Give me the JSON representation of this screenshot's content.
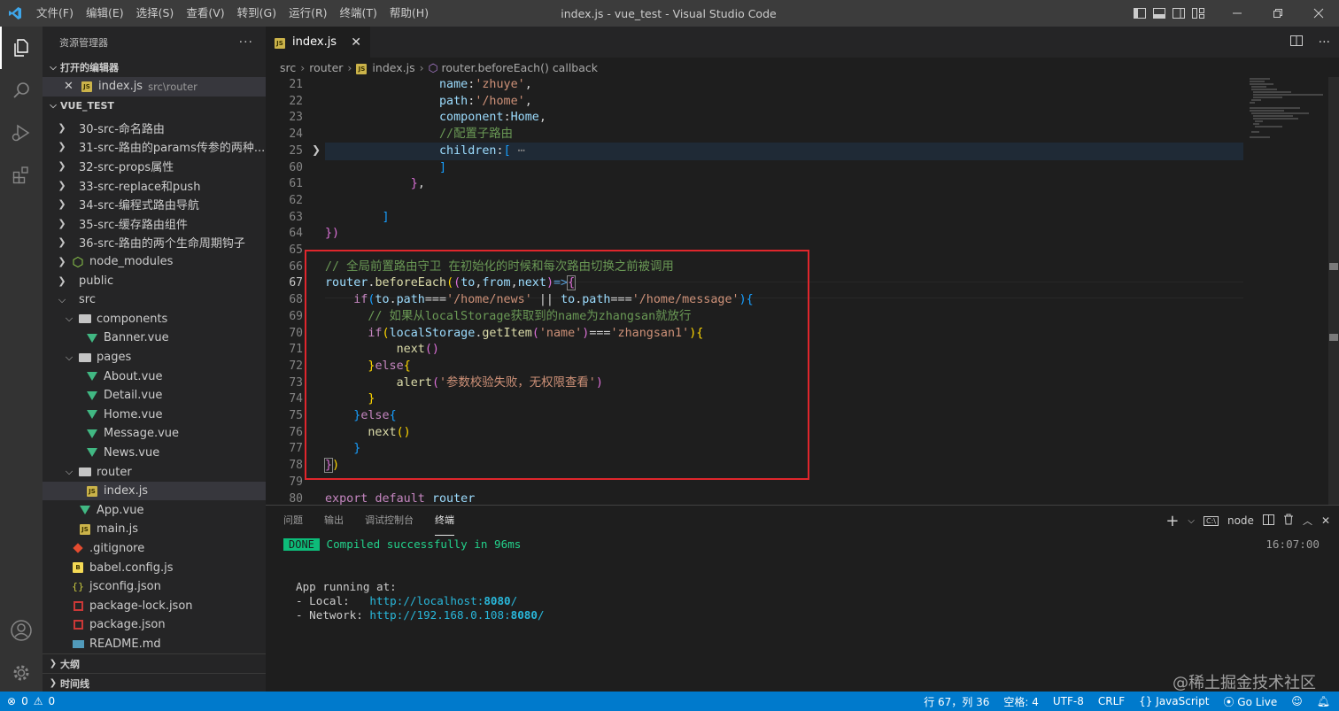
{
  "titlebar": {
    "menus": [
      "文件(F)",
      "编辑(E)",
      "选择(S)",
      "查看(V)",
      "转到(G)",
      "运行(R)",
      "终端(T)",
      "帮助(H)"
    ],
    "title": "index.js - vue_test - Visual Studio Code"
  },
  "sidebar": {
    "title": "资源管理器",
    "open_editors_label": "打开的编辑器",
    "open_file": "index.js",
    "open_file_path": "src\\router",
    "project_label": "VUE_TEST",
    "tree": [
      "30-src-命名路由",
      "31-src-路由的params传参的两种...",
      "32-src-props属性",
      "33-src-replace和push",
      "34-src-编程式路由导航",
      "35-src-缓存路由组件",
      "36-src-路由的两个生命周期钩子",
      "node_modules",
      "public",
      "src",
      "components",
      "Banner.vue",
      "pages",
      "About.vue",
      "Detail.vue",
      "Home.vue",
      "Message.vue",
      "News.vue",
      "router",
      "index.js",
      "App.vue",
      "main.js",
      ".gitignore",
      "babel.config.js",
      "jsconfig.json",
      "package-lock.json",
      "package.json",
      "README.md"
    ],
    "outline_label": "大纲",
    "timeline_label": "时间线"
  },
  "tab": {
    "name": "index.js"
  },
  "breadcrumb": [
    "src",
    "router",
    "index.js",
    "router.beforeEach() callback"
  ],
  "editor": {
    "line_numbers": [
      "21",
      "22",
      "23",
      "24",
      "25",
      "60",
      "61",
      "62",
      "63",
      "64",
      "65",
      "66",
      "67",
      "68",
      "69",
      "70",
      "71",
      "72",
      "73",
      "74",
      "75",
      "76",
      "77",
      "78",
      "79",
      "80"
    ]
  },
  "panel": {
    "tabs": [
      "问题",
      "输出",
      "调试控制台",
      "终端"
    ],
    "shell": "node",
    "done": "DONE",
    "compiled": "Compiled successfully in 96ms",
    "time": "16:07:00",
    "running": "App running at:",
    "local_label": "- Local:   ",
    "local_url_a": "http://localhost:",
    "local_port": "8080",
    "slash": "/",
    "network_label": "- Network: ",
    "network_url_a": "http://192.168.0.108:"
  },
  "status": {
    "errors": "0",
    "warnings": "0",
    "position": "行 67，列 36",
    "spaces": "空格: 4",
    "encoding": "UTF-8",
    "eol": "CRLF",
    "language": "JavaScript",
    "golive": "Go Live"
  },
  "watermark": "@稀土掘金技术社区"
}
